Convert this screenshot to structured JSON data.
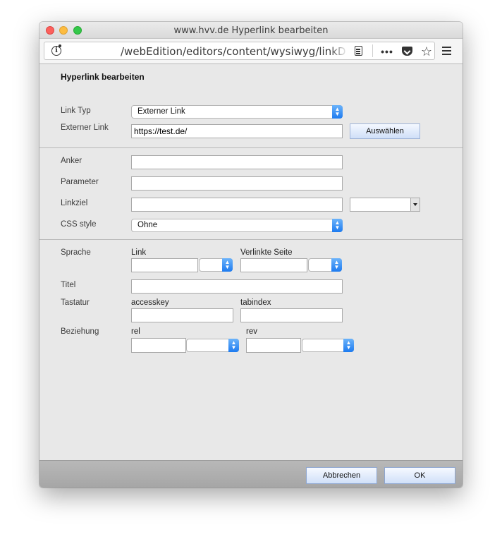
{
  "window": {
    "title": "www.hvv.de Hyperlink bearbeiten"
  },
  "urlbar": {
    "url": "/webEdition/editors/content/wysiwyg/linkDialog.php"
  },
  "toolbar": {
    "more": "•••",
    "star": "☆"
  },
  "dialog": {
    "heading": "Hyperlink bearbeiten",
    "link_type": {
      "label": "Link Typ",
      "value": "Externer Link"
    },
    "external_link": {
      "label": "Externer Link",
      "value": "https://test.de/",
      "button": "Auswählen"
    },
    "anchor": {
      "label": "Anker",
      "value": ""
    },
    "parameter": {
      "label": "Parameter",
      "value": ""
    },
    "link_target": {
      "label": "Linkziel",
      "value": ""
    },
    "css_style": {
      "label": "CSS style",
      "value": "Ohne"
    },
    "language": {
      "label": "Sprache",
      "link_label": "Link",
      "linked_page_label": "Verlinkte Seite"
    },
    "title": {
      "label": "Titel",
      "value": ""
    },
    "keyboard": {
      "label": "Tastatur",
      "accesskey_label": "accesskey",
      "tabindex_label": "tabindex"
    },
    "relation": {
      "label": "Beziehung",
      "rel_label": "rel",
      "rev_label": "rev"
    }
  },
  "footer": {
    "cancel": "Abbrechen",
    "ok": "OK"
  }
}
